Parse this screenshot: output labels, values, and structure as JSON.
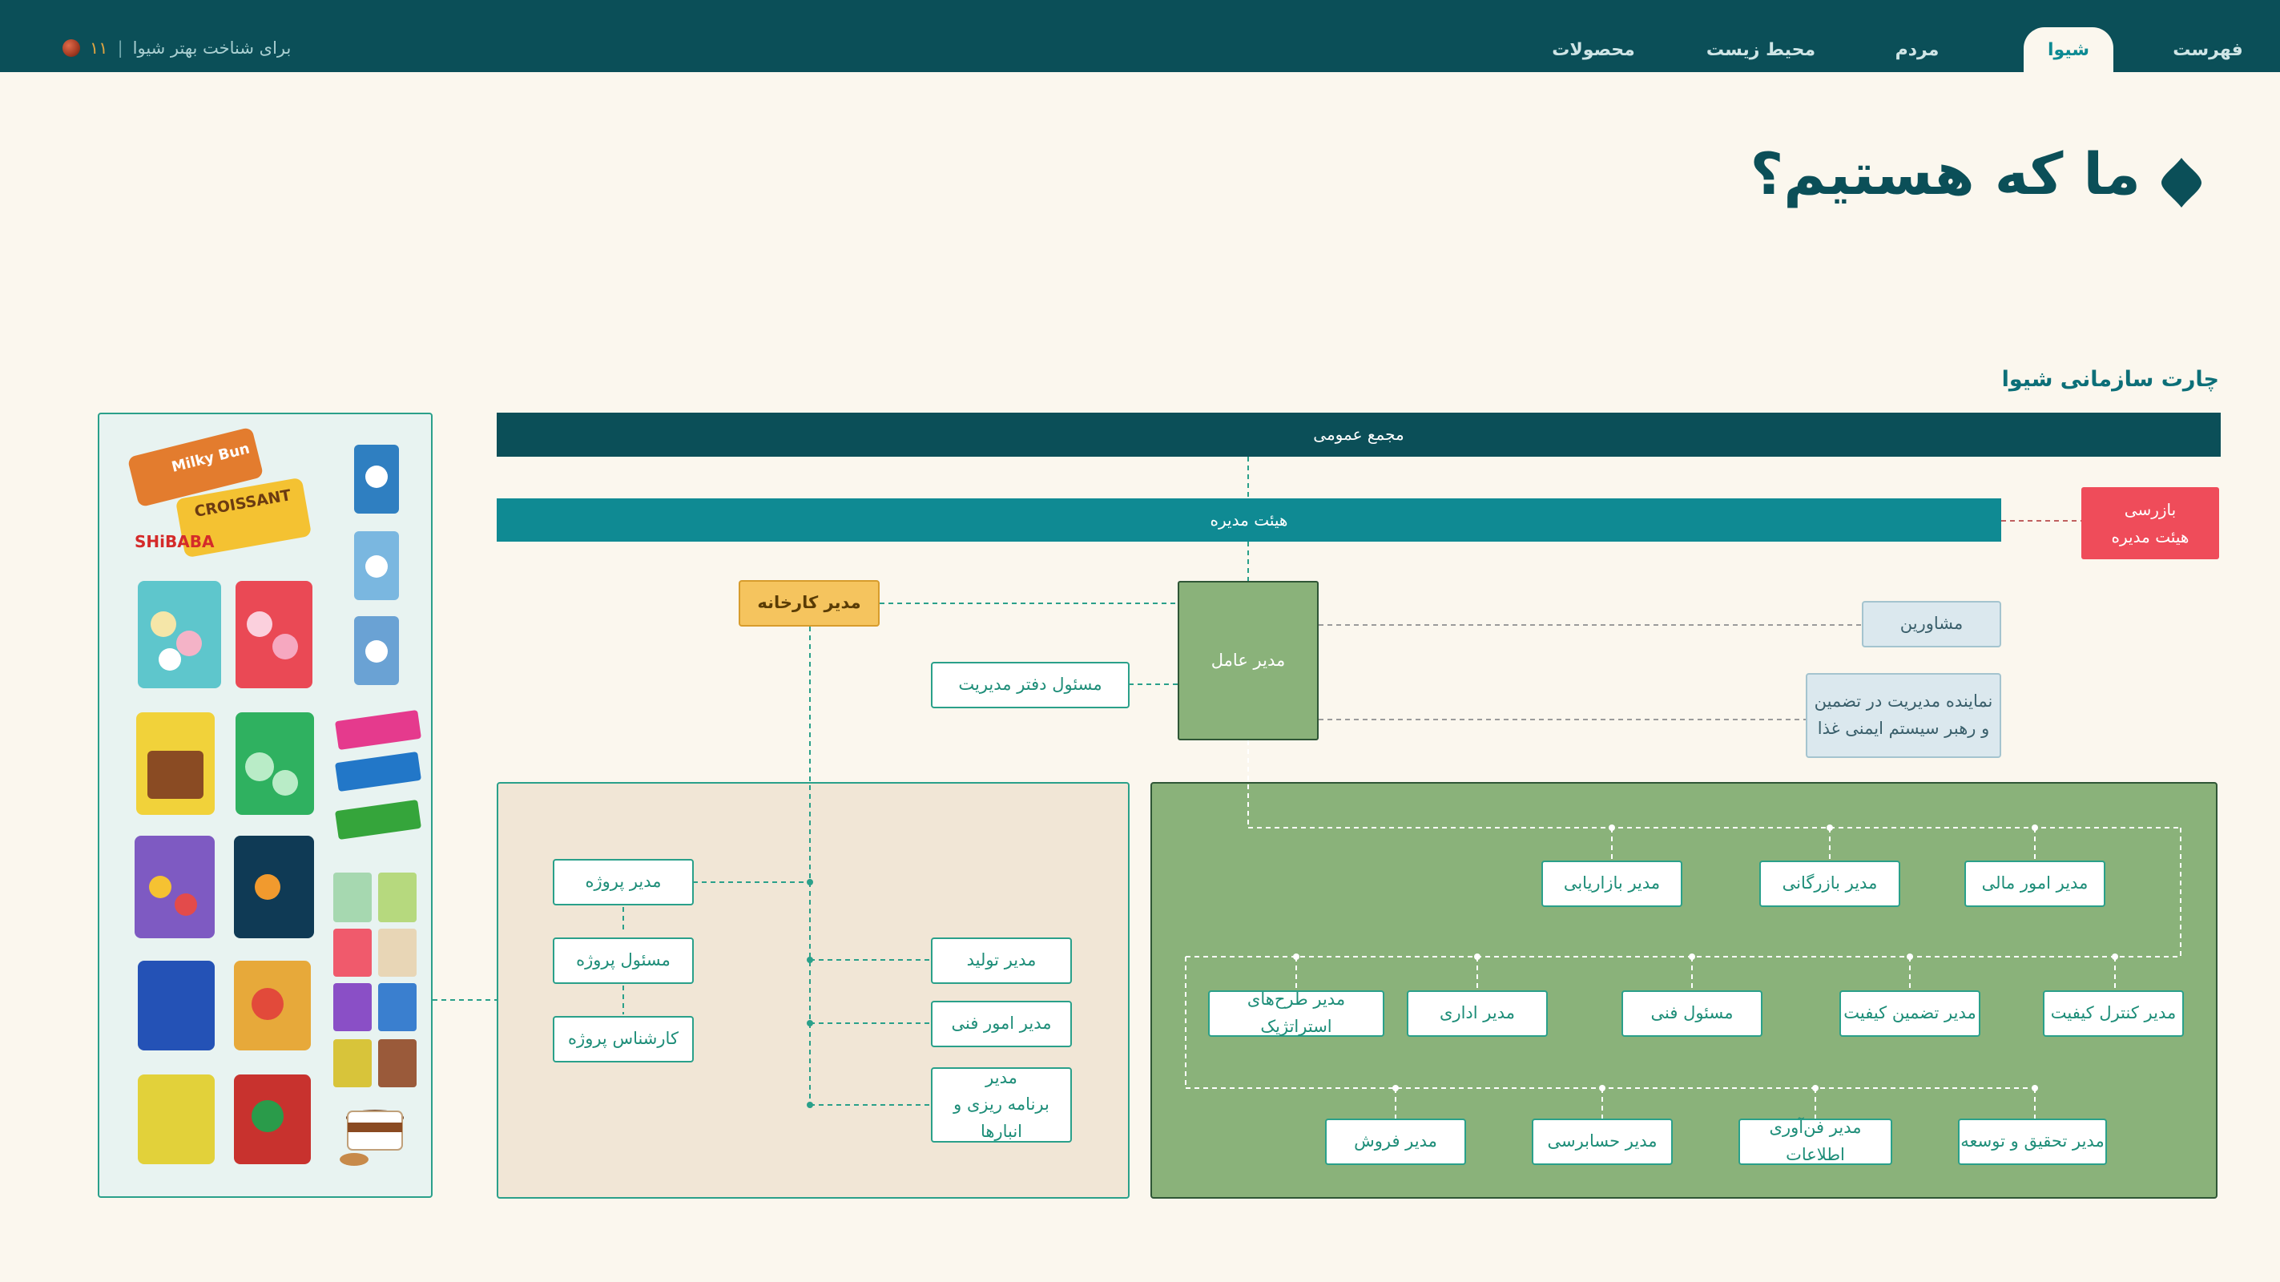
{
  "nav": {
    "tabs": [
      {
        "label": "فهرست",
        "active": false
      },
      {
        "label": "شیوا",
        "active": true
      },
      {
        "label": "مردم",
        "active": false
      },
      {
        "label": "محیط زیست",
        "active": false
      },
      {
        "label": "محصولات",
        "active": false
      }
    ],
    "breadcrumb": {
      "text": "برای شناخت بهتر شیوا",
      "separator": "|",
      "page_number": "۱۱"
    }
  },
  "page": {
    "title": "ما که هستیم؟",
    "section_title": "چارت سازمانی شیوا"
  },
  "org_chart": {
    "general_assembly": "مجمع عمومی",
    "board": "هیئت مدیره",
    "inspector": {
      "line1": "بازرسی",
      "line2": "هیئت مدیره"
    },
    "ceo": "مدیر عامل",
    "factory_manager": "مدیر کارخانه",
    "office_manager": "مسئول دفتر مدیریت",
    "advisors": "مشاورین",
    "qa_representative": {
      "line1": "نماینده مدیریت در تضمین",
      "line2": "و رهبر سیستم ایمنی غذا"
    },
    "factory_panel": {
      "project_manager": "مدیر پروژه",
      "project_officer": "مسئول پروژه",
      "project_expert": "کارشناس پروژه",
      "production_manager": "مدیر تولید",
      "technical_affairs_manager": "مدیر امور فنی",
      "planning_manager": {
        "line1": "مدیر",
        "line2": "برنامه ریزی و انبارها"
      }
    },
    "ceo_panel": {
      "row1": [
        "مدیر امور مالی",
        "مدیر بازرگانی",
        "مدیر بازاریابی"
      ],
      "row2": [
        "مدیر کنترل کیفیت",
        "مدیر تضمین کیفیت",
        "مسئول فنی",
        "مدیر اداری",
        "مدیر طرح‌های استراتژیک"
      ],
      "row3": [
        "مدیر تحقیق و توسعه",
        "مدیر فن‌آوری اطلاعات",
        "مدیر حسابرسی",
        "مدیر فروش"
      ]
    }
  },
  "products": {
    "logo_text": "SHiBABA",
    "croissant_text": "CROISSANT",
    "milky_text": "Milky Bun",
    "items": [
      "croissant-pack",
      "marshmallow-pack",
      "jelly-pack",
      "chocolate-wafer",
      "gum-pack",
      "candy-bag",
      "spread-jar"
    ]
  },
  "colors": {
    "topbar": "#0b4f58",
    "accent_teal": "#0d8a93",
    "board_bar": "#0f8a93",
    "assembly_bar": "#0b4f58",
    "inspector": "#ef4c5a",
    "factory_manager": "#f5c45e",
    "ceo": "#8ab27a",
    "ceo_panel": "#8ab27a",
    "factory_panel": "#f1e6d6",
    "products_panel": "#e8f3f1"
  }
}
